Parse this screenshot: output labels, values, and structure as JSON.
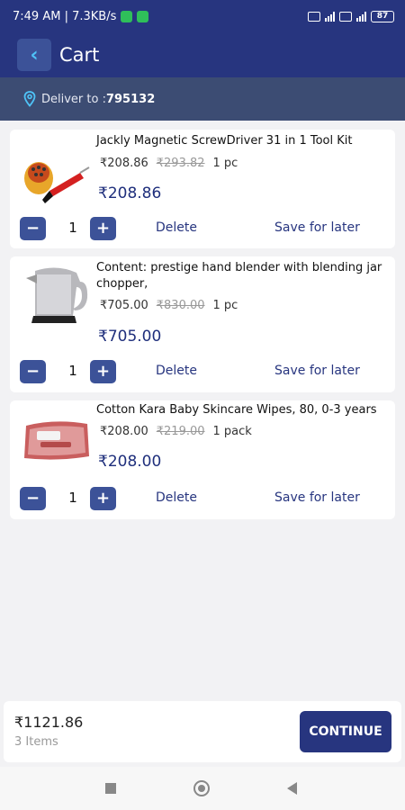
{
  "status_bar": {
    "time_speed": "7:49 AM | 7.3KB/s",
    "battery": "87"
  },
  "header": {
    "back_icon": "chevron-left-icon",
    "title": "Cart"
  },
  "delivery": {
    "label": "Deliver to : ",
    "pincode": "795132",
    "icon": "location-pin-icon"
  },
  "cart": {
    "items": [
      {
        "name": "Jackly Magnetic ScrewDriver 31 in 1 Tool Kit",
        "price": "₹208.86",
        "mrp": "₹293.82",
        "unit": "1 pc",
        "total": "₹208.86",
        "quantity": "1",
        "delete_label": "Delete",
        "save_label": "Save for later",
        "minus": "−",
        "plus": "+"
      },
      {
        "name": "Content: prestige hand blender with blending jar chopper,",
        "price": "₹705.00",
        "mrp": "₹830.00",
        "unit": "1 pc",
        "total": "₹705.00",
        "quantity": "1",
        "delete_label": "Delete",
        "save_label": "Save for later",
        "minus": "−",
        "plus": "+"
      },
      {
        "name": "Cotton Kara Baby Skincare Wipes, 80, 0-3 years",
        "price": "₹208.00",
        "mrp": "₹219.00",
        "unit": "1 pack",
        "total": "₹208.00",
        "quantity": "1",
        "delete_label": "Delete",
        "save_label": "Save for later",
        "minus": "−",
        "plus": "+"
      }
    ]
  },
  "summary": {
    "total": "₹1121.86",
    "items_count": "3 Items",
    "continue_label": "CONTINUE"
  },
  "colors": {
    "primary": "#27357f",
    "button": "#3c5298",
    "delivery_bar": "#3c4c73"
  }
}
